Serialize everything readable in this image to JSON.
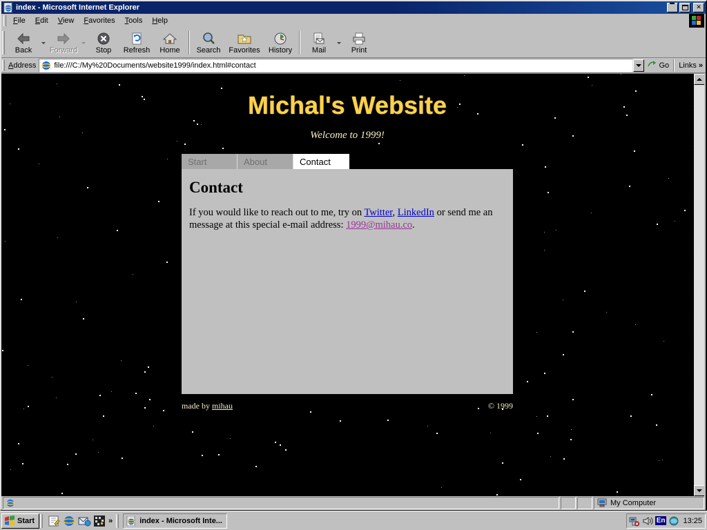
{
  "window": {
    "title": "index - Microsoft Internet Explorer",
    "title_icon": "ie-document-icon",
    "minimize_label": "Minimize",
    "restore_label": "Restore",
    "close_label": "Close",
    "close_glyph": "✕"
  },
  "menubar": {
    "items": [
      {
        "pre": "F",
        "rest": "ile",
        "name": "menu-file"
      },
      {
        "pre": "E",
        "rest": "dit",
        "name": "menu-edit"
      },
      {
        "pre": "V",
        "rest": "iew",
        "name": "menu-view"
      },
      {
        "pre": "F",
        "rest": "avorites",
        "name": "menu-favorites"
      },
      {
        "pre": "T",
        "rest": "ools",
        "name": "menu-tools"
      },
      {
        "pre": "H",
        "rest": "elp",
        "name": "menu-help"
      }
    ]
  },
  "toolbar": {
    "back": "Back",
    "forward": "Forward",
    "stop": "Stop",
    "refresh": "Refresh",
    "home": "Home",
    "search": "Search",
    "favorites": "Favorites",
    "history": "History",
    "mail": "Mail",
    "print": "Print"
  },
  "address": {
    "label_pre": "A",
    "label_rest": "ddress",
    "url": "file:///C:/My%20Documents/website1999/index.html#contact",
    "go_label": "Go",
    "links_label": "Links",
    "links_chevron": "»"
  },
  "page": {
    "site_title": "Michal's Website",
    "tagline": "Welcome to 1999!",
    "tabs": [
      {
        "label": "Start",
        "active": false
      },
      {
        "label": "About",
        "active": false
      },
      {
        "label": "Contact",
        "active": true
      }
    ],
    "heading": "Contact",
    "body": {
      "part1": "If you would like to reach out to me, try on ",
      "link_twitter": "Twitter",
      "sep1": ", ",
      "link_linkedin": "LinkedIn",
      "part2": " or send me an message at this special e-mail address: ",
      "link_email": "1999@mihau.co",
      "part3": "."
    },
    "footer": {
      "made_by_prefix": "made by ",
      "made_by_link": "mihau",
      "copyright": "© 1999"
    },
    "colors": {
      "title": "#ffd24a",
      "tagline": "#f5ecc0",
      "link": "#0000cc",
      "visited_link": "#993399",
      "panel_bg": "#c0c0c0",
      "page_bg": "#000000"
    }
  },
  "statusbar": {
    "message": "",
    "zone": "My Computer",
    "zone_icon": "computer-icon"
  },
  "taskbar": {
    "start_label": "Start",
    "quicklaunch": [
      {
        "name": "show-desktop-icon"
      },
      {
        "name": "internet-explorer-icon"
      },
      {
        "name": "outlook-express-icon"
      },
      {
        "name": "media-player-icon"
      }
    ],
    "quicklaunch_chevron": "»",
    "tasks": [
      {
        "label": "index - Microsoft Inte...",
        "icon": "ie-document-icon"
      }
    ],
    "tray": {
      "language": "En",
      "clock": "13:25",
      "icons": [
        "network-icon",
        "volume-icon",
        "display-icon"
      ]
    }
  }
}
